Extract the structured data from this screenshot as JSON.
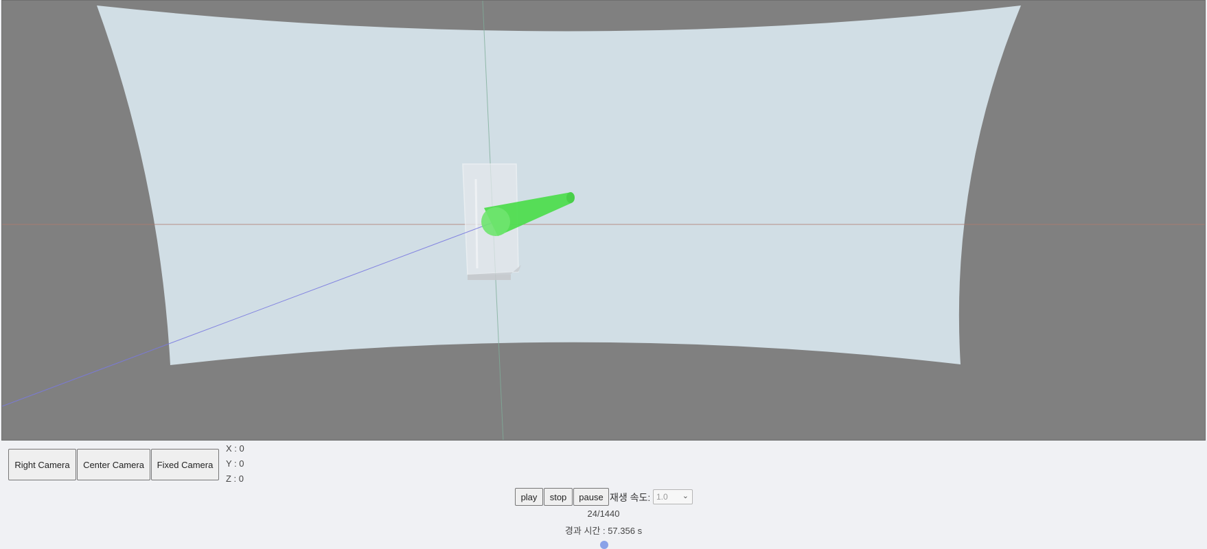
{
  "camera_buttons": {
    "right_label": "Right Camera",
    "center_label": "Center Camera",
    "fixed_label": "Fixed Camera"
  },
  "coordinates": {
    "x_text": "X : 0",
    "y_text": "Y : 0",
    "z_text": "Z : 0"
  },
  "playback": {
    "play_label": "play",
    "stop_label": "stop",
    "pause_label": "pause",
    "speed_label": "재생 속도:",
    "speed_value": "1.0",
    "frame_counter": "24/1440",
    "elapsed_time": "경과 시간 : 57.356 s"
  },
  "colors": {
    "viewport_background": "#808080",
    "screen_surface": "#d1dee5",
    "pointer_cone": "#4fdc4f",
    "x_axis": "#b07a6e",
    "y_axis": "#7fae9a",
    "z_axis": "#7a7ae0"
  }
}
